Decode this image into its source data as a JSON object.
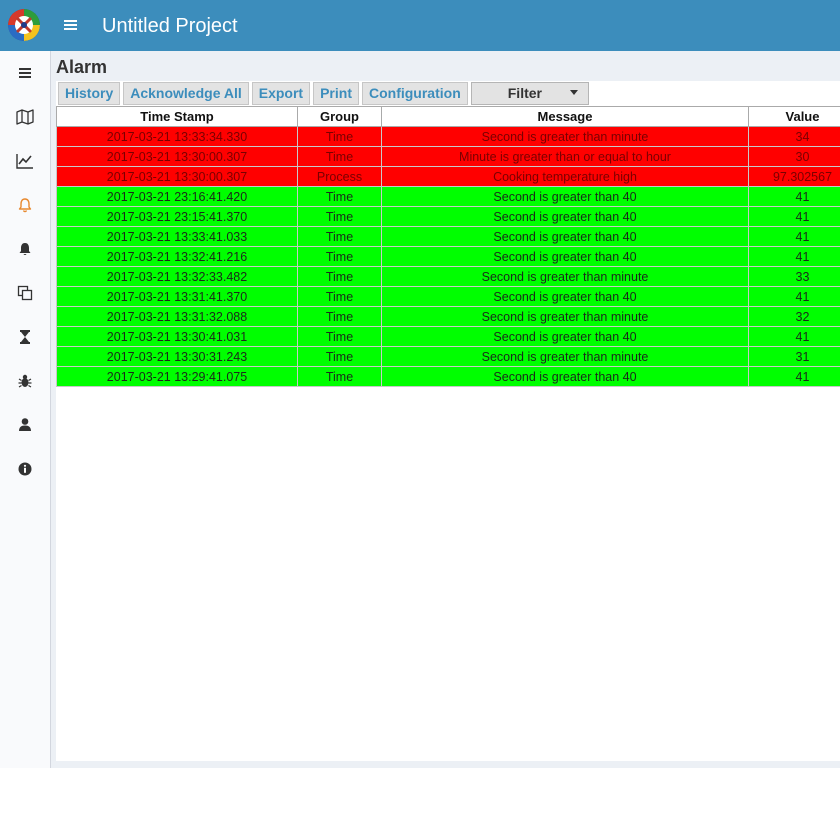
{
  "header": {
    "title": "Untitled Project",
    "logo_icon": "app-logo-icon",
    "menu_icon": "hamburger-icon",
    "bar_color": "#3c8dbc"
  },
  "sidebar": {
    "items": [
      {
        "name": "sidebar-item-menu",
        "icon": "bars-icon",
        "color": "#333333"
      },
      {
        "name": "sidebar-item-map",
        "icon": "map-icon",
        "color": "#333333"
      },
      {
        "name": "sidebar-item-chart",
        "icon": "line-chart-icon",
        "color": "#333333"
      },
      {
        "name": "sidebar-item-alarms",
        "icon": "bell-outline-icon",
        "color": "#e8892f"
      },
      {
        "name": "sidebar-item-notifications",
        "icon": "bell-icon",
        "color": "#333333"
      },
      {
        "name": "sidebar-item-copy",
        "icon": "copy-icon",
        "color": "#333333"
      },
      {
        "name": "sidebar-item-history",
        "icon": "hourglass-icon",
        "color": "#333333"
      },
      {
        "name": "sidebar-item-debug",
        "icon": "bug-icon",
        "color": "#333333"
      },
      {
        "name": "sidebar-item-user",
        "icon": "user-icon",
        "color": "#333333"
      },
      {
        "name": "sidebar-item-info",
        "icon": "info-icon",
        "color": "#333333"
      }
    ]
  },
  "page": {
    "title": "Alarm"
  },
  "toolbar": {
    "history_label": "History",
    "ack_all_label": "Acknowledge All",
    "export_label": "Export",
    "print_label": "Print",
    "config_label": "Configuration",
    "filter_label": "Filter"
  },
  "table": {
    "columns": [
      "Time Stamp",
      "Group",
      "Message",
      "Value"
    ],
    "rows": [
      {
        "state": "active",
        "time": "2017-03-21 13:33:34.330",
        "group": "Time",
        "message": "Second is greater than minute",
        "value": "34"
      },
      {
        "state": "active",
        "time": "2017-03-21 13:30:00.307",
        "group": "Time",
        "message": "Minute is greater than or equal to hour",
        "value": "30"
      },
      {
        "state": "active",
        "time": "2017-03-21 13:30:00.307",
        "group": "Process",
        "message": "Cooking temperature high",
        "value": "97.302567"
      },
      {
        "state": "cleared",
        "time": "2017-03-21 23:16:41.420",
        "group": "Time",
        "message": "Second is greater than 40",
        "value": "41"
      },
      {
        "state": "cleared",
        "time": "2017-03-21 23:15:41.370",
        "group": "Time",
        "message": "Second is greater than 40",
        "value": "41"
      },
      {
        "state": "cleared",
        "time": "2017-03-21 13:33:41.033",
        "group": "Time",
        "message": "Second is greater than 40",
        "value": "41"
      },
      {
        "state": "cleared",
        "time": "2017-03-21 13:32:41.216",
        "group": "Time",
        "message": "Second is greater than 40",
        "value": "41"
      },
      {
        "state": "cleared",
        "time": "2017-03-21 13:32:33.482",
        "group": "Time",
        "message": "Second is greater than minute",
        "value": "33"
      },
      {
        "state": "cleared",
        "time": "2017-03-21 13:31:41.370",
        "group": "Time",
        "message": "Second is greater than 40",
        "value": "41"
      },
      {
        "state": "cleared",
        "time": "2017-03-21 13:31:32.088",
        "group": "Time",
        "message": "Second is greater than minute",
        "value": "32"
      },
      {
        "state": "cleared",
        "time": "2017-03-21 13:30:41.031",
        "group": "Time",
        "message": "Second is greater than 40",
        "value": "41"
      },
      {
        "state": "cleared",
        "time": "2017-03-21 13:30:31.243",
        "group": "Time",
        "message": "Second is greater than minute",
        "value": "31"
      },
      {
        "state": "cleared",
        "time": "2017-03-21 13:29:41.075",
        "group": "Time",
        "message": "Second is greater than 40",
        "value": "41"
      }
    ]
  },
  "colors": {
    "active_alarm": "#ff0000",
    "cleared_alarm": "#00ff00",
    "accent": "#3c8dbc"
  }
}
